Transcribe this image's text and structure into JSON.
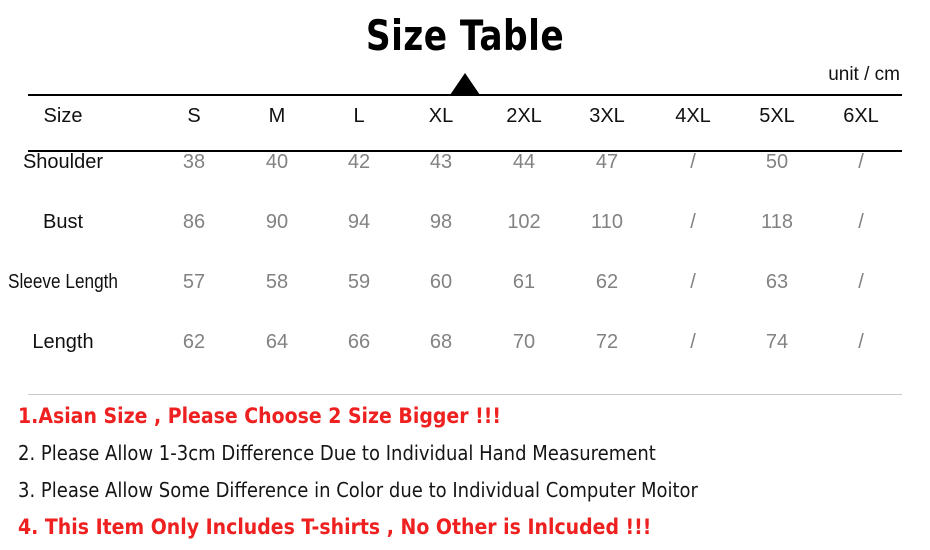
{
  "title": "Size Table",
  "unit_note": "unit / cm",
  "marker": "triangle-marker",
  "colors": {
    "title": "#000000",
    "header_text": "#111111",
    "value_text": "#828282",
    "warning_red": "#ee2020",
    "rule": "#000000"
  },
  "table": {
    "columns": [
      "Size",
      "S",
      "M",
      "L",
      "XL",
      "2XL",
      "3XL",
      "4XL",
      "5XL",
      "6XL"
    ],
    "rows": [
      {
        "label": "Shoulder",
        "values": [
          "38",
          "40",
          "42",
          "43",
          "44",
          "47",
          "/",
          "50",
          "/"
        ]
      },
      {
        "label": "Bust",
        "values": [
          "86",
          "90",
          "94",
          "98",
          "102",
          "110",
          "/",
          "118",
          "/"
        ]
      },
      {
        "label": "Sleeve Length",
        "values": [
          "57",
          "58",
          "59",
          "60",
          "61",
          "62",
          "/",
          "63",
          "/"
        ]
      },
      {
        "label": "Length",
        "values": [
          "62",
          "64",
          "66",
          "68",
          "70",
          "72",
          "/",
          "74",
          "/"
        ]
      }
    ]
  },
  "notes": [
    {
      "text": "1.Asian Size , Please Choose 2 Size Bigger !!!",
      "style": "red"
    },
    {
      "text": "2. Please Allow 1-3cm Difference Due to Individual Hand Measurement",
      "style": "black"
    },
    {
      "text": "3. Please Allow Some Difference in Color due to Individual Computer Moitor",
      "style": "black"
    },
    {
      "text": "4. This Item Only Includes T-shirts , No Other is Inlcuded !!!",
      "style": "red"
    }
  ]
}
